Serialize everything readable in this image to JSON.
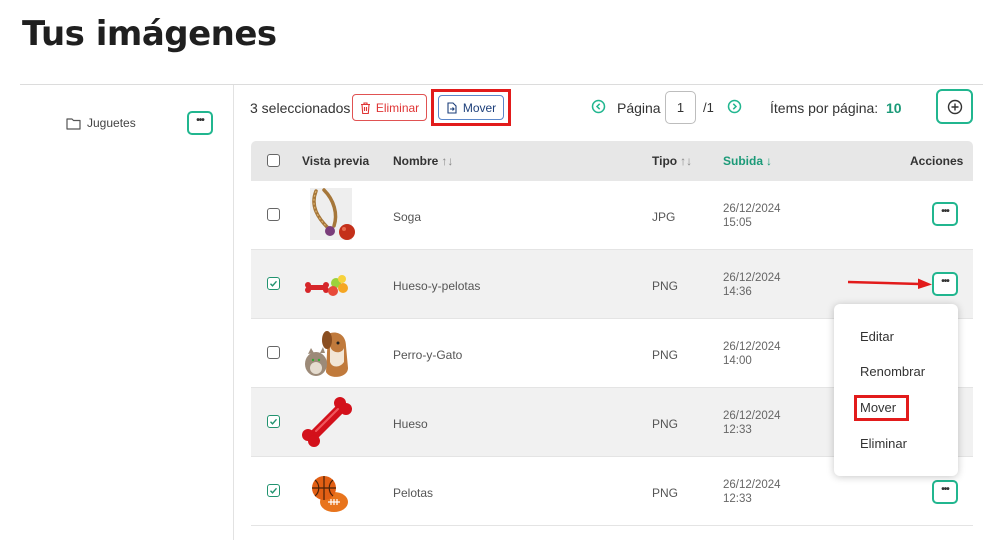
{
  "page_title": "Tus imágenes",
  "sidebar": {
    "folder_label": "Juguetes"
  },
  "toolbar": {
    "selected_count": "3 seleccionados",
    "delete_label": "Eliminar",
    "move_label": "Mover",
    "page_label": "Página",
    "page_value": "1",
    "page_total": "/1",
    "per_page_label": "Ítems por página:",
    "per_page_value": "10"
  },
  "table": {
    "headers": {
      "preview": "Vista previa",
      "name": "Nombre",
      "type": "Tipo",
      "uploaded": "Subida",
      "actions": "Acciones"
    },
    "rows": [
      {
        "name": "Soga",
        "type": "JPG",
        "date": "26/12/2024",
        "time": "15:05",
        "checked": false
      },
      {
        "name": "Hueso-y-pelotas",
        "type": "PNG",
        "date": "26/12/2024",
        "time": "14:36",
        "checked": true
      },
      {
        "name": "Perro-y-Gato",
        "type": "PNG",
        "date": "26/12/2024",
        "time": "14:00",
        "checked": false
      },
      {
        "name": "Hueso",
        "type": "PNG",
        "date": "26/12/2024",
        "time": "12:33",
        "checked": true
      },
      {
        "name": "Pelotas",
        "type": "PNG",
        "date": "26/12/2024",
        "time": "12:33",
        "checked": true
      }
    ]
  },
  "context_menu": {
    "edit": "Editar",
    "rename": "Renombrar",
    "move": "Mover",
    "delete": "Eliminar"
  },
  "colors": {
    "accent": "#21b68f",
    "danger": "#e03535",
    "highlight": "#e21b1b",
    "move_button_border": "#5b86c9"
  }
}
